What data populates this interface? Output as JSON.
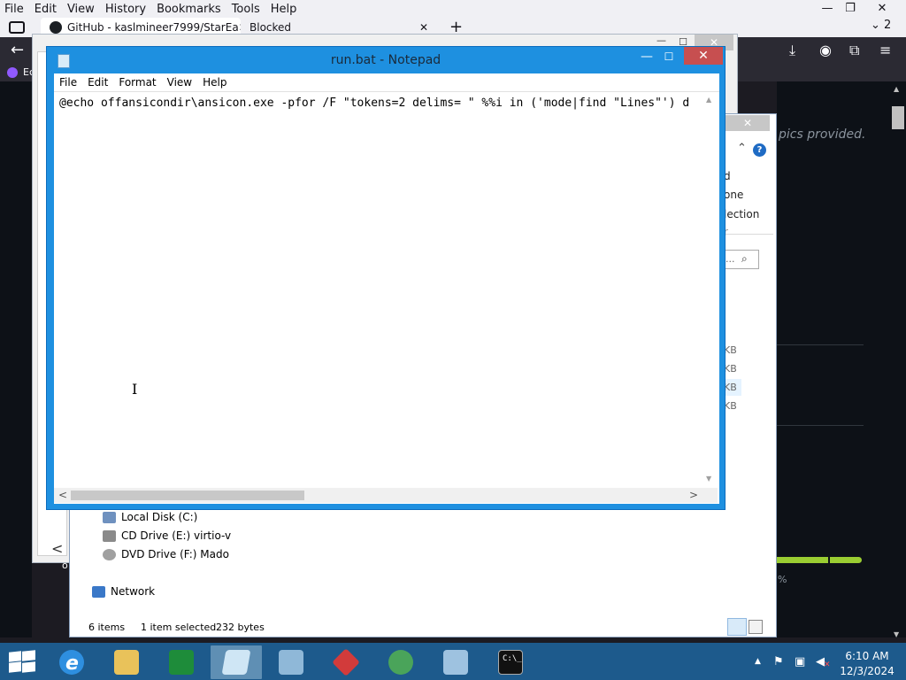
{
  "firefox": {
    "menubar": [
      "File",
      "Edit",
      "View",
      "History",
      "Bookmarks",
      "Tools",
      "Help"
    ],
    "tabs": [
      {
        "label": "GitHub - kaslmineer7999/StarEa",
        "close": "✕"
      },
      {
        "label": "Blocked",
        "close": "✕"
      }
    ],
    "new_tab": "+",
    "list_all_tabs": "⌄ 2",
    "window_buttons": {
      "minimize": "—",
      "restore": "❐",
      "close": "✕"
    },
    "bookmark_label": "Ec",
    "icons": {
      "back": "←",
      "download": "⤓",
      "account": "◉",
      "extensions": "⧉",
      "menu": "≡"
    }
  },
  "github_page": {
    "topics_text": "pics provided.",
    "lang_percent": "%"
  },
  "bg_dialog": {
    "buttons": {
      "minimize": "—",
      "maximize": "☐",
      "close": "✕"
    },
    "left_arrow": "<",
    "ok_fragment": "o"
  },
  "explorer": {
    "close": "✕",
    "chevron": "⌃",
    "help": "?",
    "ribbon_fragments": [
      "d",
      "one",
      "lection",
      "r"
    ],
    "search_placeholder": "...",
    "search_icon": "⌕",
    "size_fragments": [
      "KB",
      "KB",
      "KB",
      "KB"
    ],
    "nav": {
      "local_disk": "Local Disk (C:)",
      "cd_drive": "CD Drive (E:) virtio-v",
      "dvd_drive": "DVD Drive (F:) Mado",
      "network": "Network"
    },
    "status": {
      "items": "6 items",
      "selected": "1 item selected",
      "size": "232 bytes"
    }
  },
  "notepad": {
    "title": "run.bat - Notepad",
    "menu": [
      "File",
      "Edit",
      "Format",
      "View",
      "Help"
    ],
    "content": "@echo offansicondir\\ansicon.exe -pfor /F \"tokens=2 delims= \" %%i in ('mode|find \"Lines\"') d",
    "buttons": {
      "minimize": "—",
      "maximize": "☐",
      "close": "✕"
    },
    "scroll": {
      "up": "▲",
      "down": "▼",
      "left": "<",
      "right": ">"
    },
    "hscroll_fraction": 0.38,
    "cursor": "I"
  },
  "taskbar": {
    "apps": [
      "internet-explorer",
      "file-explorer",
      "store",
      "notepad",
      "pictures",
      "red-app",
      "globe-app",
      "network-config",
      "command-prompt"
    ],
    "cmd_prompt": "C:\\_",
    "ie_letter": "e",
    "tray": {
      "up": "▲",
      "flag": "⚑",
      "network": "▣",
      "volume": "◀",
      "volume_muted": "✕"
    },
    "clock": {
      "time": "6:10 AM",
      "date": "12/3/2024"
    }
  },
  "colors": {
    "firefox_toolbar": "#2b2a33",
    "github_bg": "#0d1117",
    "notepad_frame": "#1e90e0",
    "notepad_close": "#c74f50",
    "taskbar": "#1d5a8c",
    "lang_bar": "#9acd32"
  }
}
